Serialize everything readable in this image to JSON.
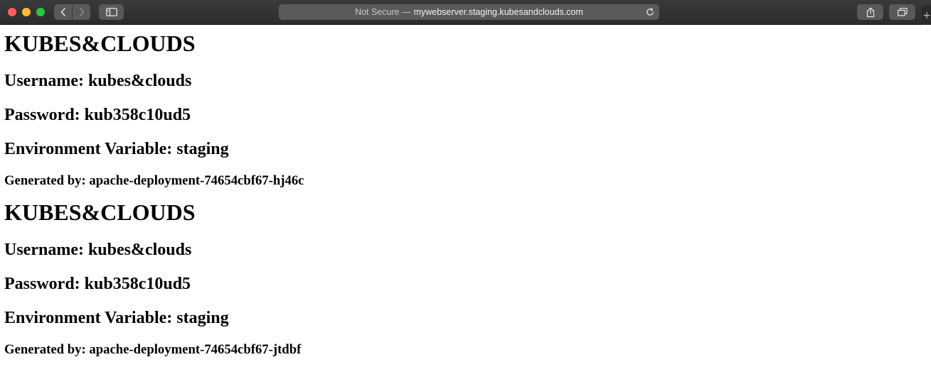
{
  "browser": {
    "address_prefix": "Not Secure —",
    "address_host": "mywebserver.staging.kubesandclouds.com",
    "new_tab_label": "+"
  },
  "page": {
    "blocks": [
      {
        "title": "KUBES&CLOUDS",
        "username": "Username: kubes&clouds",
        "password": "Password: kub358c10ud5",
        "env": "Environment Variable: staging",
        "generated": "Generated by: apache-deployment-74654cbf67-hj46c"
      },
      {
        "title": "KUBES&CLOUDS",
        "username": "Username: kubes&clouds",
        "password": "Password: kub358c10ud5",
        "env": "Environment Variable: staging",
        "generated": "Generated by: apache-deployment-74654cbf67-jtdbf"
      }
    ]
  },
  "icons": {
    "close": "close-icon",
    "minimize": "minimize-icon",
    "zoom": "zoom-icon",
    "back": "chevron-left-icon",
    "forward": "chevron-right-icon",
    "sidebar": "sidebar-icon",
    "reload": "reload-icon",
    "share": "share-icon",
    "tabs": "tab-overview-icon"
  },
  "colors": {
    "close": "#ff5f57",
    "minimize": "#febc2e",
    "zoom": "#28c840",
    "toolbar": "#2c2c2e",
    "address_bar": "#5a5a5d"
  }
}
